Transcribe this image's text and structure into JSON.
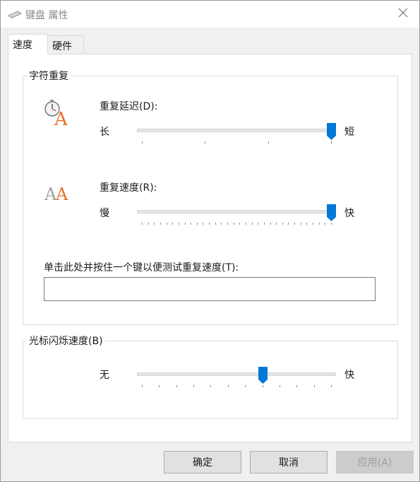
{
  "window": {
    "title": "键盘 属性",
    "icon": "keyboard-icon",
    "close_icon": "close-icon"
  },
  "tabs": [
    {
      "label": "速度",
      "active": true
    },
    {
      "label": "硬件",
      "active": false
    }
  ],
  "char_repeat": {
    "group_label": "字符重复",
    "delay": {
      "icon": "stopwatch-letter-a-icon",
      "label": "重复延迟(D):",
      "min_label": "长",
      "max_label": "短",
      "tick_count": 4,
      "value_fraction": 1.0
    },
    "rate": {
      "icon": "double-letter-a-icon",
      "label": "重复速度(R):",
      "min_label": "慢",
      "max_label": "快",
      "tick_count": 32,
      "value_fraction": 1.0
    },
    "test": {
      "label": "单击此处并按住一个键以便测试重复速度(T):",
      "value": ""
    }
  },
  "cursor_blink": {
    "group_label": "光标闪烁速度(B)",
    "min_label": "无",
    "max_label": "快",
    "tick_count": 12,
    "value_fraction": 0.64
  },
  "buttons": {
    "ok": "确定",
    "cancel": "取消",
    "apply": "应用(A)"
  },
  "colors": {
    "accent": "#0078d7",
    "letter_orange": "#e8702a",
    "letter_gray": "#a0a0a0"
  }
}
